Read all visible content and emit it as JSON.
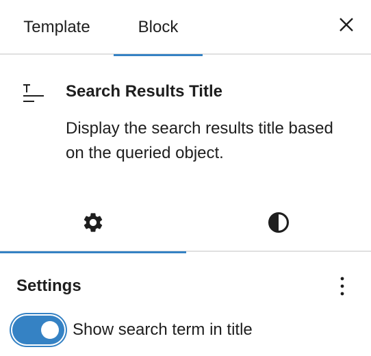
{
  "top_tabs": {
    "template": "Template",
    "block": "Block",
    "active": "block",
    "close_icon": "close-icon"
  },
  "block_card": {
    "icon": "title-icon",
    "title": "Search Results Title",
    "description": "Display the search results title based on the queried object."
  },
  "sub_tabs": {
    "settings_icon": "gear-icon",
    "styles_icon": "half-circle-icon",
    "active": "settings"
  },
  "settings": {
    "title": "Settings",
    "more_icon": "vertical-ellipsis-icon",
    "toggle": {
      "label": "Show search term in title",
      "checked": true
    }
  },
  "colors": {
    "accent": "#3582c4",
    "text": "#1e1e1e",
    "divider": "#e0e0e0"
  }
}
